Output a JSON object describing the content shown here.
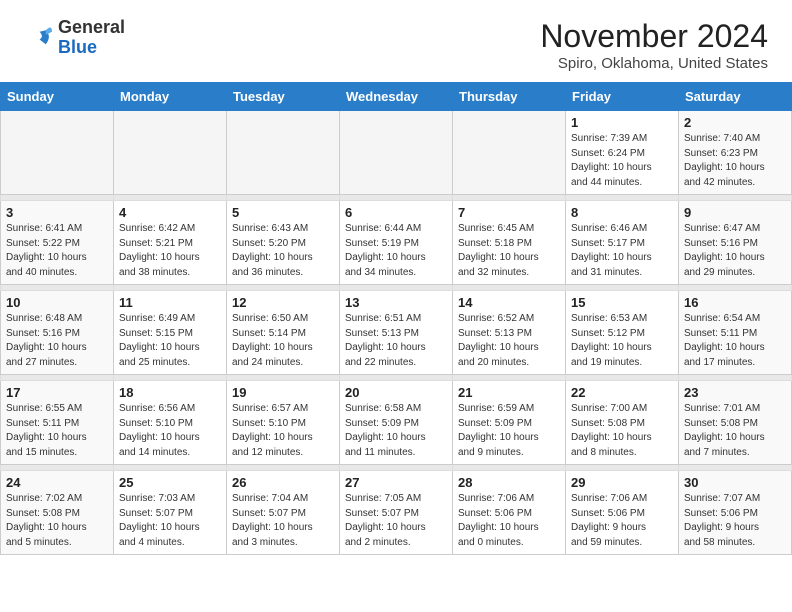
{
  "header": {
    "logo_general": "General",
    "logo_blue": "Blue",
    "month_title": "November 2024",
    "location": "Spiro, Oklahoma, United States"
  },
  "weekdays": [
    "Sunday",
    "Monday",
    "Tuesday",
    "Wednesday",
    "Thursday",
    "Friday",
    "Saturday"
  ],
  "weeks": [
    [
      {
        "day": "",
        "info": ""
      },
      {
        "day": "",
        "info": ""
      },
      {
        "day": "",
        "info": ""
      },
      {
        "day": "",
        "info": ""
      },
      {
        "day": "",
        "info": ""
      },
      {
        "day": "1",
        "info": "Sunrise: 7:39 AM\nSunset: 6:24 PM\nDaylight: 10 hours\nand 44 minutes."
      },
      {
        "day": "2",
        "info": "Sunrise: 7:40 AM\nSunset: 6:23 PM\nDaylight: 10 hours\nand 42 minutes."
      }
    ],
    [
      {
        "day": "3",
        "info": "Sunrise: 6:41 AM\nSunset: 5:22 PM\nDaylight: 10 hours\nand 40 minutes."
      },
      {
        "day": "4",
        "info": "Sunrise: 6:42 AM\nSunset: 5:21 PM\nDaylight: 10 hours\nand 38 minutes."
      },
      {
        "day": "5",
        "info": "Sunrise: 6:43 AM\nSunset: 5:20 PM\nDaylight: 10 hours\nand 36 minutes."
      },
      {
        "day": "6",
        "info": "Sunrise: 6:44 AM\nSunset: 5:19 PM\nDaylight: 10 hours\nand 34 minutes."
      },
      {
        "day": "7",
        "info": "Sunrise: 6:45 AM\nSunset: 5:18 PM\nDaylight: 10 hours\nand 32 minutes."
      },
      {
        "day": "8",
        "info": "Sunrise: 6:46 AM\nSunset: 5:17 PM\nDaylight: 10 hours\nand 31 minutes."
      },
      {
        "day": "9",
        "info": "Sunrise: 6:47 AM\nSunset: 5:16 PM\nDaylight: 10 hours\nand 29 minutes."
      }
    ],
    [
      {
        "day": "10",
        "info": "Sunrise: 6:48 AM\nSunset: 5:16 PM\nDaylight: 10 hours\nand 27 minutes."
      },
      {
        "day": "11",
        "info": "Sunrise: 6:49 AM\nSunset: 5:15 PM\nDaylight: 10 hours\nand 25 minutes."
      },
      {
        "day": "12",
        "info": "Sunrise: 6:50 AM\nSunset: 5:14 PM\nDaylight: 10 hours\nand 24 minutes."
      },
      {
        "day": "13",
        "info": "Sunrise: 6:51 AM\nSunset: 5:13 PM\nDaylight: 10 hours\nand 22 minutes."
      },
      {
        "day": "14",
        "info": "Sunrise: 6:52 AM\nSunset: 5:13 PM\nDaylight: 10 hours\nand 20 minutes."
      },
      {
        "day": "15",
        "info": "Sunrise: 6:53 AM\nSunset: 5:12 PM\nDaylight: 10 hours\nand 19 minutes."
      },
      {
        "day": "16",
        "info": "Sunrise: 6:54 AM\nSunset: 5:11 PM\nDaylight: 10 hours\nand 17 minutes."
      }
    ],
    [
      {
        "day": "17",
        "info": "Sunrise: 6:55 AM\nSunset: 5:11 PM\nDaylight: 10 hours\nand 15 minutes."
      },
      {
        "day": "18",
        "info": "Sunrise: 6:56 AM\nSunset: 5:10 PM\nDaylight: 10 hours\nand 14 minutes."
      },
      {
        "day": "19",
        "info": "Sunrise: 6:57 AM\nSunset: 5:10 PM\nDaylight: 10 hours\nand 12 minutes."
      },
      {
        "day": "20",
        "info": "Sunrise: 6:58 AM\nSunset: 5:09 PM\nDaylight: 10 hours\nand 11 minutes."
      },
      {
        "day": "21",
        "info": "Sunrise: 6:59 AM\nSunset: 5:09 PM\nDaylight: 10 hours\nand 9 minutes."
      },
      {
        "day": "22",
        "info": "Sunrise: 7:00 AM\nSunset: 5:08 PM\nDaylight: 10 hours\nand 8 minutes."
      },
      {
        "day": "23",
        "info": "Sunrise: 7:01 AM\nSunset: 5:08 PM\nDaylight: 10 hours\nand 7 minutes."
      }
    ],
    [
      {
        "day": "24",
        "info": "Sunrise: 7:02 AM\nSunset: 5:08 PM\nDaylight: 10 hours\nand 5 minutes."
      },
      {
        "day": "25",
        "info": "Sunrise: 7:03 AM\nSunset: 5:07 PM\nDaylight: 10 hours\nand 4 minutes."
      },
      {
        "day": "26",
        "info": "Sunrise: 7:04 AM\nSunset: 5:07 PM\nDaylight: 10 hours\nand 3 minutes."
      },
      {
        "day": "27",
        "info": "Sunrise: 7:05 AM\nSunset: 5:07 PM\nDaylight: 10 hours\nand 2 minutes."
      },
      {
        "day": "28",
        "info": "Sunrise: 7:06 AM\nSunset: 5:06 PM\nDaylight: 10 hours\nand 0 minutes."
      },
      {
        "day": "29",
        "info": "Sunrise: 7:06 AM\nSunset: 5:06 PM\nDaylight: 9 hours\nand 59 minutes."
      },
      {
        "day": "30",
        "info": "Sunrise: 7:07 AM\nSunset: 5:06 PM\nDaylight: 9 hours\nand 58 minutes."
      }
    ]
  ]
}
